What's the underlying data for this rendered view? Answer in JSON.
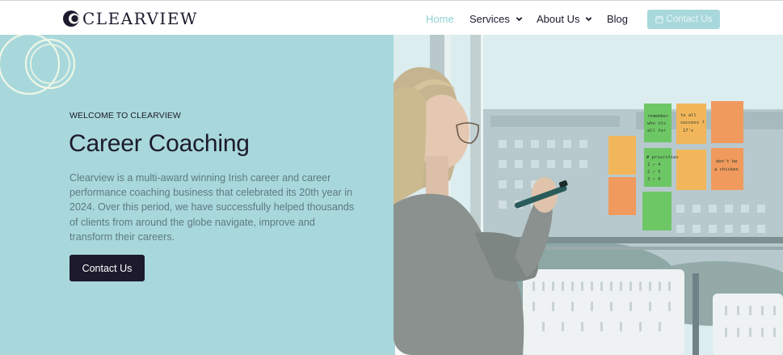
{
  "brand": {
    "name": "CLEARVIEW"
  },
  "nav": {
    "home": "Home",
    "services": "Services",
    "about": "About Us",
    "blog": "Blog",
    "cta": "Contact Us"
  },
  "hero": {
    "eyebrow": "WELCOME TO CLEARVIEW",
    "title": "Career Coaching",
    "description": "Clearview is a multi-award winning Irish career and career performance coaching business that celebrated its 20th year in 2024. Over this period, we have successfully helped thousands of clients from around the globe navigate, improve and transform their careers.",
    "cta": "Contact Us"
  },
  "notes": {
    "green1": [
      "remember",
      "who its",
      "all for"
    ],
    "orange1": [
      "to all",
      "success ?",
      "17's"
    ],
    "green2": [
      "# priorities",
      "1 ✓ 4",
      "2 ✓ 5",
      "3 ✓ 6"
    ],
    "orange2": [
      "don't be",
      "a chicken"
    ]
  },
  "colors": {
    "brand_dark": "#1d1a2d",
    "accent": "#a8d8db",
    "nav_active": "#8fd1d3",
    "body_text": "#5d7a82"
  },
  "icons": [
    "logo-mark-icon",
    "chevron-down-icon",
    "calendar-icon",
    "decorative-circles"
  ]
}
